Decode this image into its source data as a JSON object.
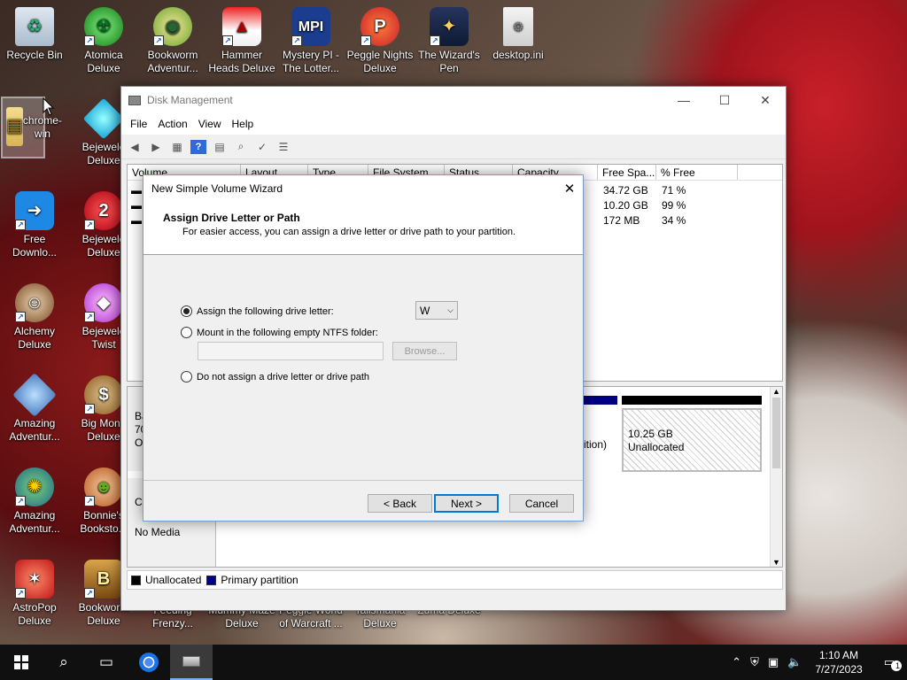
{
  "desktop": {
    "icons": [
      {
        "label": "Recycle Bin",
        "icon": "recycle-bin-icon"
      },
      {
        "label": "Atomica Deluxe",
        "icon": "atomica-icon"
      },
      {
        "label": "Bookworm Adventur...",
        "icon": "bookworm-icon"
      },
      {
        "label": "Hammer Heads Deluxe",
        "icon": "hammer-heads-icon"
      },
      {
        "label": "Mystery PI - The Lotter...",
        "icon": "mystery-pi-icon"
      },
      {
        "label": "Peggle Nights Deluxe",
        "icon": "peggle-nights-icon"
      },
      {
        "label": "The Wizard's Pen",
        "icon": "wizards-pen-icon"
      },
      {
        "label": "desktop.ini",
        "icon": "file-icon"
      },
      {
        "label": "chrome-win",
        "icon": "folder-icon"
      },
      {
        "label": "Bejewele Deluxe",
        "icon": "bejeweled-icon"
      },
      {
        "label": "Free Downlo...",
        "icon": "free-download-icon"
      },
      {
        "label": "Bejewele Deluxe",
        "icon": "bejeweled2-icon"
      },
      {
        "label": "Alchemy Deluxe",
        "icon": "alchemy-icon"
      },
      {
        "label": "Bejewele Twist",
        "icon": "bejeweled-twist-icon"
      },
      {
        "label": "Amazing Adventur...",
        "icon": "amazing-adventures-icon"
      },
      {
        "label": "Big Mone Deluxe",
        "icon": "big-money-icon"
      },
      {
        "label": "Amazing Adventur...",
        "icon": "amazing-adventures2-icon"
      },
      {
        "label": "Bonnie's Booksto...",
        "icon": "bonnies-bookstore-icon"
      },
      {
        "label": "AstroPop Deluxe",
        "icon": "astropop-icon"
      },
      {
        "label": "Bookworm Deluxe",
        "icon": "bookworm-deluxe-icon"
      },
      {
        "label": "Feeding Frenzy...",
        "icon": "feeding-frenzy-icon"
      },
      {
        "label": "Mummy Maze Deluxe",
        "icon": "mummy-maze-icon"
      },
      {
        "label": "Peggle World of Warcraft ...",
        "icon": "peggle-wow-icon"
      },
      {
        "label": "Talismania Deluxe",
        "icon": "talismania-icon"
      },
      {
        "label": "Zuma Deluxe",
        "icon": "zuma-icon"
      }
    ]
  },
  "disk_management": {
    "title": "Disk Management",
    "menu": [
      "File",
      "Action",
      "View",
      "Help"
    ],
    "columns": [
      "Volume",
      "Layout",
      "Type",
      "File System",
      "Status",
      "Capacity",
      "Free Spa...",
      "% Free"
    ],
    "rows": [
      {
        "free": "34.72 GB",
        "pct": "71 %"
      },
      {
        "free": "10.20 GB",
        "pct": "99 %"
      },
      {
        "free": "172 MB",
        "pct": "34 %"
      }
    ],
    "disk_left_partial": [
      "Ba",
      "70",
      "O"
    ],
    "disk_partial_label": "ition)",
    "unallocated_size": "10.25 GB",
    "unallocated_label": "Unallocated",
    "cd_partial": "Cl",
    "no_media": "No Media",
    "legend": {
      "unallocated": "Unallocated",
      "primary": "Primary partition",
      "unallocated_color": "#000000",
      "primary_color": "#000080"
    }
  },
  "wizard": {
    "title": "New Simple Volume Wizard",
    "heading": "Assign Drive Letter or Path",
    "subheading": "For easier access, you can assign a drive letter or drive path to your partition.",
    "option_letter": "Assign the following drive letter:",
    "drive_letter": "W",
    "option_folder": "Mount in the following empty NTFS folder:",
    "browse": "Browse...",
    "option_none": "Do not assign a drive letter or drive path",
    "back": "< Back",
    "next": "Next >",
    "cancel": "Cancel"
  },
  "taskbar": {
    "time": "1:10 AM",
    "date": "7/27/2023",
    "notifications": "1"
  }
}
